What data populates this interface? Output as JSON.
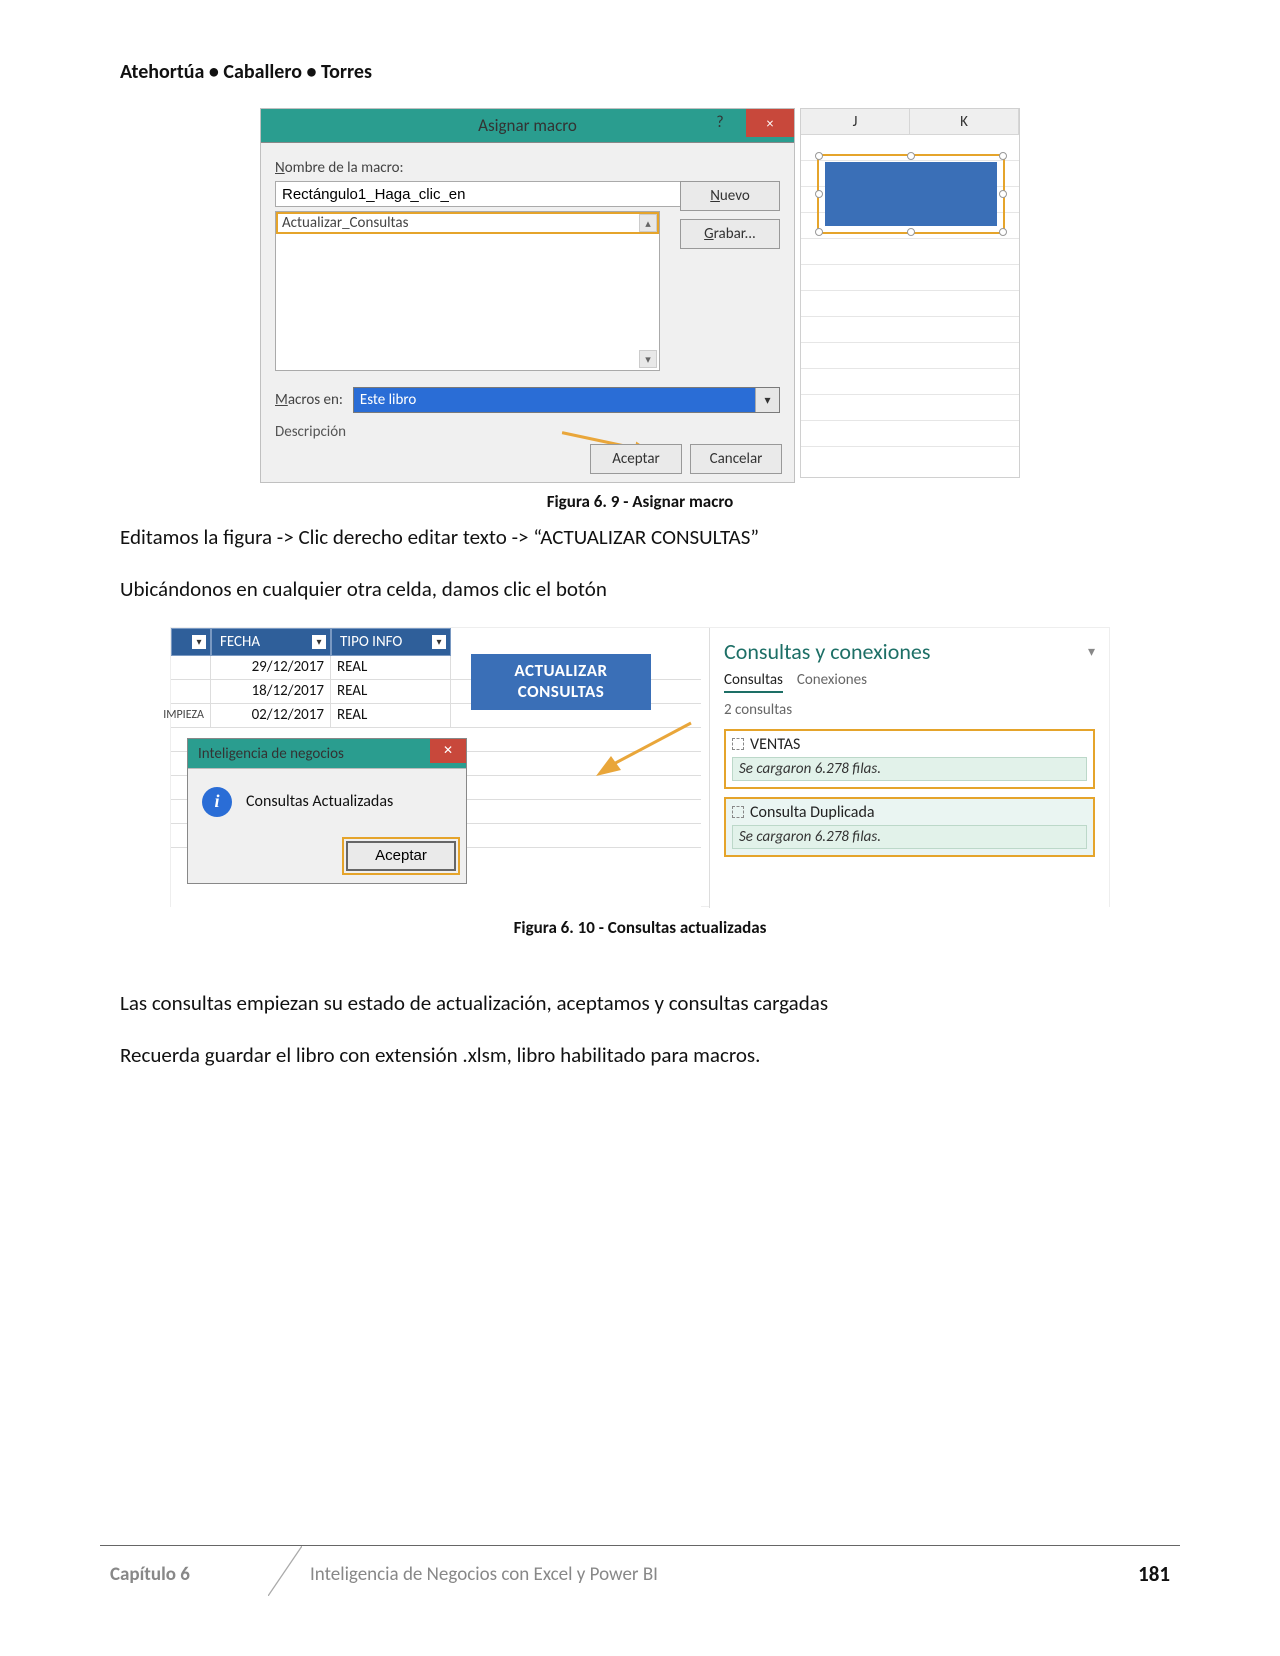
{
  "page_header": "Atehortúa • Caballero • Torres",
  "fig1": {
    "dialog": {
      "title": "Asignar macro",
      "help_tooltip": "?",
      "close_tooltip": "×",
      "macro_name_label_pre": "N",
      "macro_name_label_post": "ombre de la macro:",
      "macro_name_value": "Rectángulo1_Haga_clic_en",
      "list_item_1": "Actualizar_Consultas",
      "btn_nuevo_pre": "N",
      "btn_nuevo_post": "uevo",
      "btn_grabar_pre": "G",
      "btn_grabar_post": "rabar...",
      "macros_en_label_pre": "M",
      "macros_en_label_post": "acros en:",
      "macros_en_value": "Este libro",
      "descripcion_label": "Descripción",
      "btn_aceptar": "Aceptar",
      "btn_cancelar": "Cancelar"
    },
    "grid_cols": {
      "J": "J",
      "K": "K"
    },
    "caption": "Figura 6. 9 - Asignar macro"
  },
  "para1": "Editamos la figura -> Clic derecho editar texto -> “ACTUALIZAR CONSULTAS”",
  "para2": "Ubicándonos en cualquier otra celda, damos clic el botón",
  "fig2": {
    "table": {
      "col_fecha": "FECHA",
      "col_tipo": "TIPO INFO",
      "rows": [
        {
          "c1": "",
          "c2": "29/12/2017",
          "c3": "REAL"
        },
        {
          "c1": "",
          "c2": "18/12/2017",
          "c3": "REAL"
        },
        {
          "c1": "IMPIEZA",
          "c2": "02/12/2017",
          "c3": "REAL"
        }
      ]
    },
    "button_label": "ACTUALIZAR CONSULTAS",
    "msgbox": {
      "title": "Inteligencia de negocios",
      "body": "Consultas Actualizadas",
      "ok": "Aceptar"
    },
    "panel": {
      "title": "Consultas y conexiones",
      "tabs": {
        "consultas": "Consultas",
        "conexiones": "Conexiones"
      },
      "count": "2 consultas",
      "q1_name": "VENTAS",
      "q1_status": "Se cargaron 6.278 filas.",
      "q2_name": "Consulta Duplicada",
      "q2_status": "Se cargaron 6.278 filas."
    },
    "caption": "Figura 6. 10 - Consultas actualizadas"
  },
  "para3": "Las consultas empiezan su estado de actualización, aceptamos y consultas cargadas",
  "para4": "Recuerda guardar el libro con extensión .xlsm, libro habilitado para macros.",
  "footer": {
    "chapter": "Capítulo 6",
    "book": "Inteligencia de Negocios con Excel y Power BI",
    "page": "181"
  }
}
